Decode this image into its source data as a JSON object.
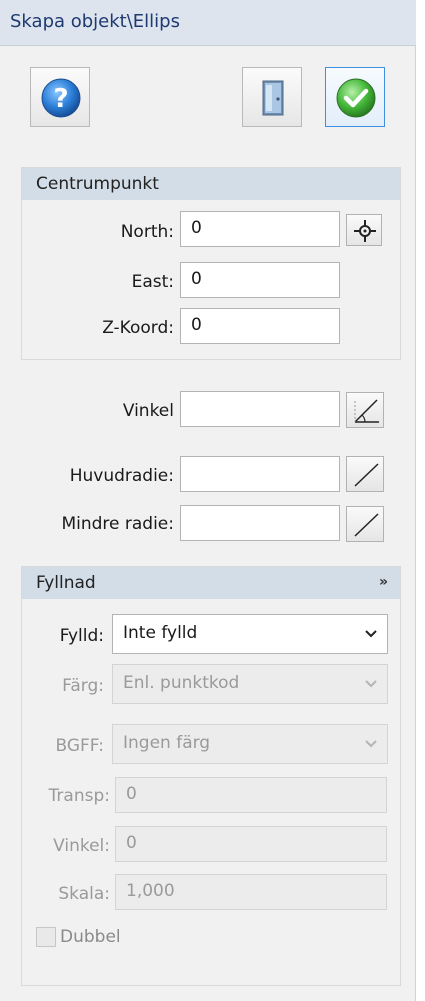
{
  "window": {
    "title": "Skapa objekt\\Ellips"
  },
  "toolbar": {
    "help_icon": "help-icon",
    "exit_icon": "door-exit-icon",
    "ok_icon": "checkmark-icon"
  },
  "centrumpunkt": {
    "header": "Centrumpunkt",
    "north_label": "North:",
    "north_value": "0",
    "east_label": "East:",
    "east_value": "0",
    "z_label": "Z-Koord:",
    "z_value": "0"
  },
  "geometry": {
    "vinkel_label": "Vinkel",
    "vinkel_value": "",
    "huvudradie_label": "Huvudradie:",
    "huvudradie_value": "",
    "mindre_radie_label": "Mindre radie:",
    "mindre_radie_value": ""
  },
  "fyllnad": {
    "header": "Fyllnad",
    "fylld_label": "Fylld:",
    "fylld_value": "Inte fylld",
    "farg_label": "Färg:",
    "farg_value": "Enl. punktkod",
    "bgff_label": "BGFF:",
    "bgff_value": "Ingen färg",
    "transp_label": "Transp:",
    "transp_value": "0",
    "vinkel_label": "Vinkel:",
    "vinkel_value": "0",
    "skala_label": "Skala:",
    "skala_value": "1,000",
    "dubbel_label": "Dubbel",
    "dubbel_checked": false
  }
}
